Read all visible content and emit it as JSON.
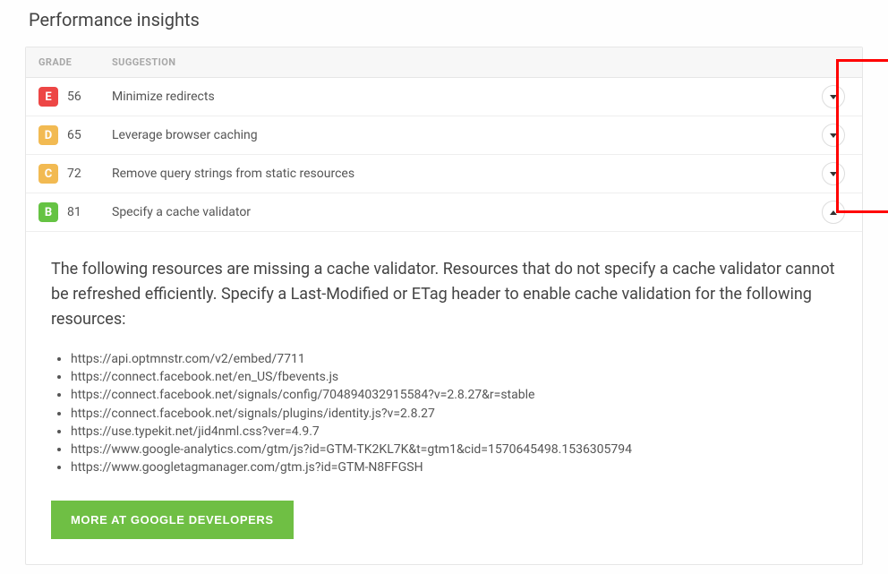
{
  "title": "Performance insights",
  "headers": {
    "grade": "GRADE",
    "suggestion": "SUGGESTION"
  },
  "rows": [
    {
      "letter": "E",
      "score": "56",
      "suggestion": "Minimize redirects",
      "expanded": false
    },
    {
      "letter": "D",
      "score": "65",
      "suggestion": "Leverage browser caching",
      "expanded": false
    },
    {
      "letter": "C",
      "score": "72",
      "suggestion": "Remove query strings from static resources",
      "expanded": false
    },
    {
      "letter": "B",
      "score": "81",
      "suggestion": "Specify a cache validator",
      "expanded": true
    }
  ],
  "expanded": {
    "description": "The following resources are missing a cache validator. Resources that do not specify a cache validator cannot be refreshed efficiently. Specify a Last-Modified or ETag header to enable cache validation for the following resources:",
    "resources": [
      "https://api.optmnstr.com/v2/embed/7711",
      "https://connect.facebook.net/en_US/fbevents.js",
      "https://connect.facebook.net/signals/config/704894032915584?v=2.8.27&r=stable",
      "https://connect.facebook.net/signals/plugins/identity.js?v=2.8.27",
      "https://use.typekit.net/jid4nml.css?ver=4.9.7",
      "https://www.google-analytics.com/gtm/js?id=GTM-TK2KL7K&t=gtm1&cid=1570645498.1536305794",
      "https://www.googletagmanager.com/gtm.js?id=GTM-N8FFGSH"
    ],
    "more_button": "MORE AT GOOGLE DEVELOPERS"
  }
}
